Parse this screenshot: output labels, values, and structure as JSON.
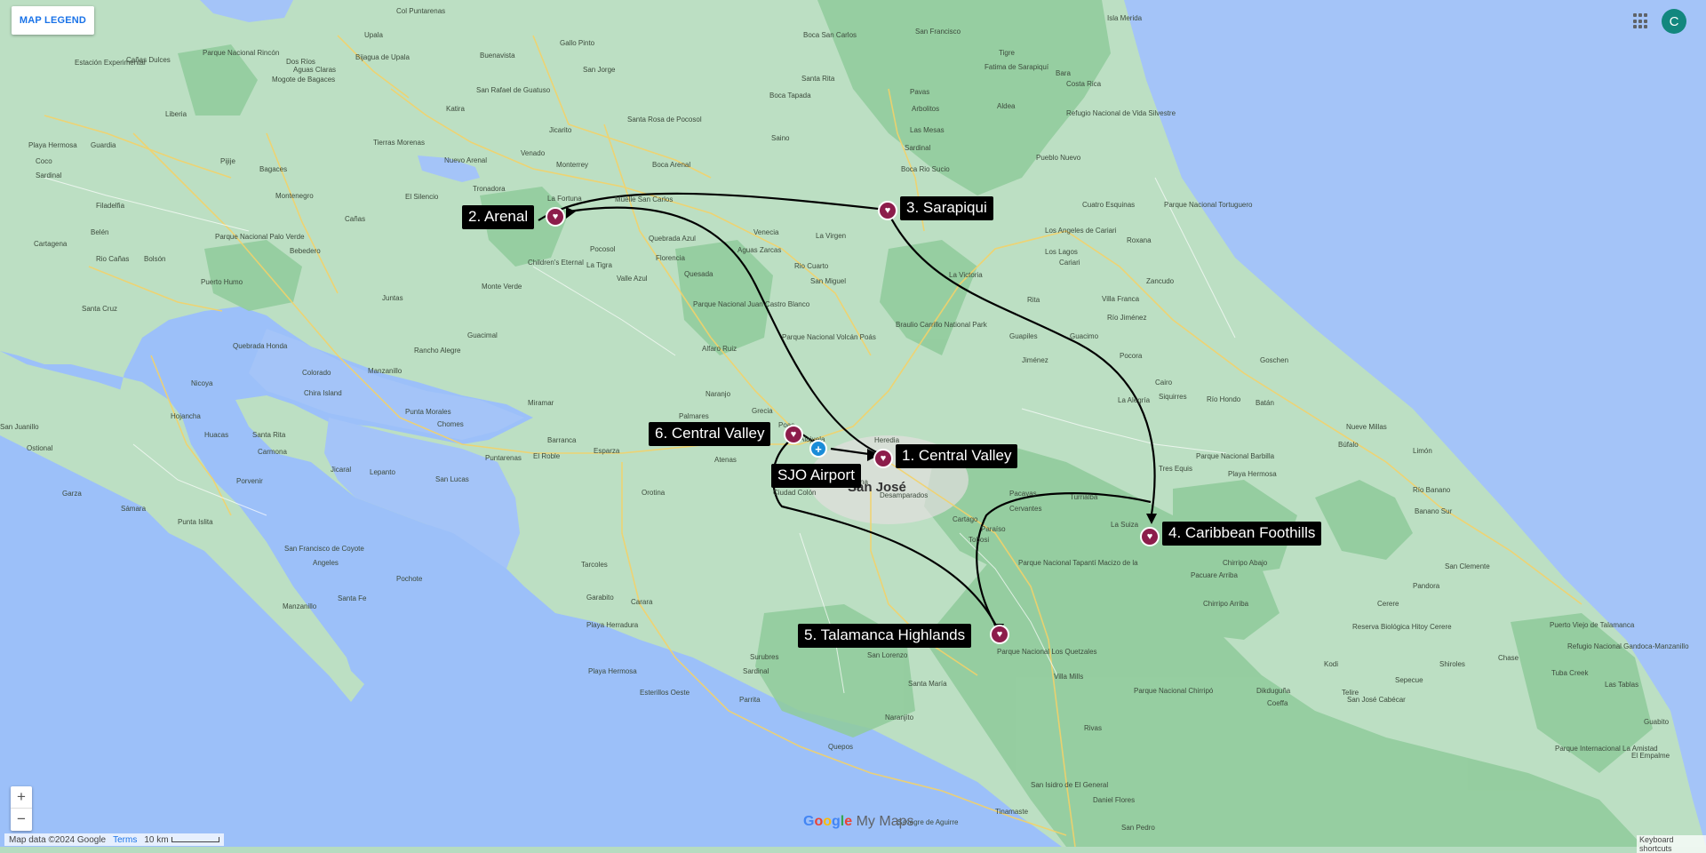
{
  "legend": {
    "label": "MAP LEGEND"
  },
  "account": {
    "initial": "C"
  },
  "zoom": {
    "in_label": "+",
    "out_label": "−"
  },
  "branding": {
    "g1": "G",
    "g2": "o",
    "g3": "o",
    "g4": "g",
    "g5": "l",
    "g6": "e",
    "product": " My Maps"
  },
  "attribution": {
    "map_data": "Map data ©2024 Google",
    "terms": "Terms",
    "scale": "10 km"
  },
  "keyboard": "Keyboard shortcuts",
  "stops": [
    {
      "label": "1. Central Valley"
    },
    {
      "label": "2. Arenal"
    },
    {
      "label": "3. Sarapiqui"
    },
    {
      "label": "4. Caribbean Foothills"
    },
    {
      "label": "5. Talamanca Highlands"
    },
    {
      "label": "6. Central Valley"
    }
  ],
  "airport": {
    "label": "SJO Airport"
  },
  "places": [
    "Col Puntarenas",
    "Boca San Carlos",
    "Boca Tapada",
    "Santa Rita",
    "Pavas",
    "Arbolitos",
    "Las Mesas",
    "Sardinal",
    "Boca Rio Sucio",
    "Aldea",
    "Bara",
    "Costa Rica",
    "Isla Merida",
    "Refugio Nacional de Vida Silvestre Barra del",
    "Parque Nacional Tortuguero",
    "Cuatro Esquinas",
    "Los Angeles de Cariari",
    "Roxana",
    "Cariari",
    "Los Lagos",
    "Zancudo",
    "Villa Franca",
    "Rita",
    "Río Jiménez",
    "Guapiles",
    "Guacimo",
    "Pocora",
    "Jiménez",
    "Goschen",
    "Cairo",
    "Siquirres",
    "Río Hondo",
    "Batán",
    "La Alegría",
    "Parque Nacional Barbilla",
    "Playa Hermosa",
    "Tres Equis",
    "La Suiza",
    "Pacuare Arriba",
    "Chirripo Abajo",
    "Chirripo Arriba",
    "Nueve Millas",
    "Búfalo",
    "Limón",
    "Río Banano",
    "Banano Sur",
    "San Clemente",
    "Pandora",
    "Cerere",
    "Reserva Biológica Hitoy Cerere",
    "Puerto Viejo de Talamanca",
    "Refugio Nacional Gandoca-Manzanillo",
    "Las Tablas",
    "Guabito",
    "El Empalme",
    "Coeffa",
    "Parque Internacional La Amistad",
    "Kodi",
    "Sepecue",
    "Shiroles",
    "Chase",
    "Tuba Creek",
    "Dikduguña",
    "San José Cabécar",
    "Parque Nacional Chirripó",
    "Telire",
    "San Isidro de El General",
    "Rivas",
    "Villa Mills",
    "Parque Nacional Los Quetzales",
    "Daniel Flores",
    "Tinamaste",
    "Savegre de Aguirre",
    "San Pedro",
    "Quepos",
    "Naranjito",
    "Santa María",
    "San Lorenzo",
    "Surubres",
    "Sardinal",
    "Parrita",
    "Esterillos Oeste",
    "Playa Hermosa",
    "Playa Herradura",
    "Garabito",
    "Carara",
    "Tarcoles",
    "Orotina",
    "Atenas",
    "Esparza",
    "Barranca",
    "Puntarenas",
    "El Roble",
    "Miramar",
    "Guacimal",
    "Manzanillo",
    "Quebrada Honda",
    "Nicoya",
    "Hojancha",
    "Huacas",
    "Santa Rita",
    "Carmona",
    "Porvenir",
    "Jicaral",
    "Lepanto",
    "San Lucas",
    "Garza",
    "Sámara",
    "Punta Islita",
    "San Francisco de Coyote",
    "Angeles",
    "Santa Fe",
    "Pochote",
    "Manzanillo",
    "Ostional",
    "San Juanillo",
    "Punta Morales",
    "Chomes",
    "Colorado",
    "Chira Island",
    "Puerto Humo",
    "Bolsón",
    "Rio Cañas",
    "Cartagena",
    "Filadelfia",
    "Belén",
    "Santa Cruz",
    "Sardinal",
    "Liberia",
    "Playa Hermosa",
    "Guardia",
    "Coco",
    "Pijije",
    "Bagaces",
    "Montenegro",
    "Cañas",
    "Bebedero",
    "Parque Nacional Palo Verde",
    "Juntas",
    "Rancho Alegre",
    "La Fortuna",
    "Nuevo Arenal",
    "Tronadora",
    "El Silencio",
    "Tierras Morenas",
    "Quebrada Azul",
    "Florencia",
    "Pocosol",
    "La Tigra",
    "Valle Azul",
    "Monte Verde",
    "Children's Eternal Rainforest",
    "Quesada",
    "Aguas Zarcas",
    "Rio Cuarto",
    "San Miguel",
    "Venecia",
    "La Virgen",
    "Monterrey",
    "Jicarito",
    "Saino",
    "Boca Arenal",
    "Muelle San Carlos",
    "San Jorge",
    "Gallo Pinto",
    "Buenavista",
    "Bijagua de Upala",
    "Upala",
    "Estación Experimental Forestal Horizontes",
    "Parque Nacional Rincón de la Vieja",
    "Cañas Dulces",
    "Dos Ríos",
    "Aguas Claras",
    "Mogote de Bagaces",
    "San Rafael de Guatuso",
    "Katira",
    "Venado",
    "Santa Rosa de Pocosol",
    "Aguas Zarcas",
    "Parque Nacional Juan Castro Blanco",
    "Parque Nacional Volcán Poás",
    "Braulio Carrillo National Park",
    "La Victoria",
    "San Francisco",
    "Tigre",
    "Fatima de Sarapiquí",
    "Pueblo Nuevo",
    "Alfaro Ruiz",
    "Naranjo",
    "Palmares",
    "Grecia",
    "Poas",
    "Alajuela",
    "Heredia",
    "San José",
    "Desamparados",
    "Ciudad Colón",
    "Cartago",
    "Paraíso",
    "Pacayas",
    "Cervantes",
    "Turrialba",
    "Parque Nacional Tapantí Macizo de la Muerte",
    "Santa Ana",
    "Tobosi"
  ]
}
